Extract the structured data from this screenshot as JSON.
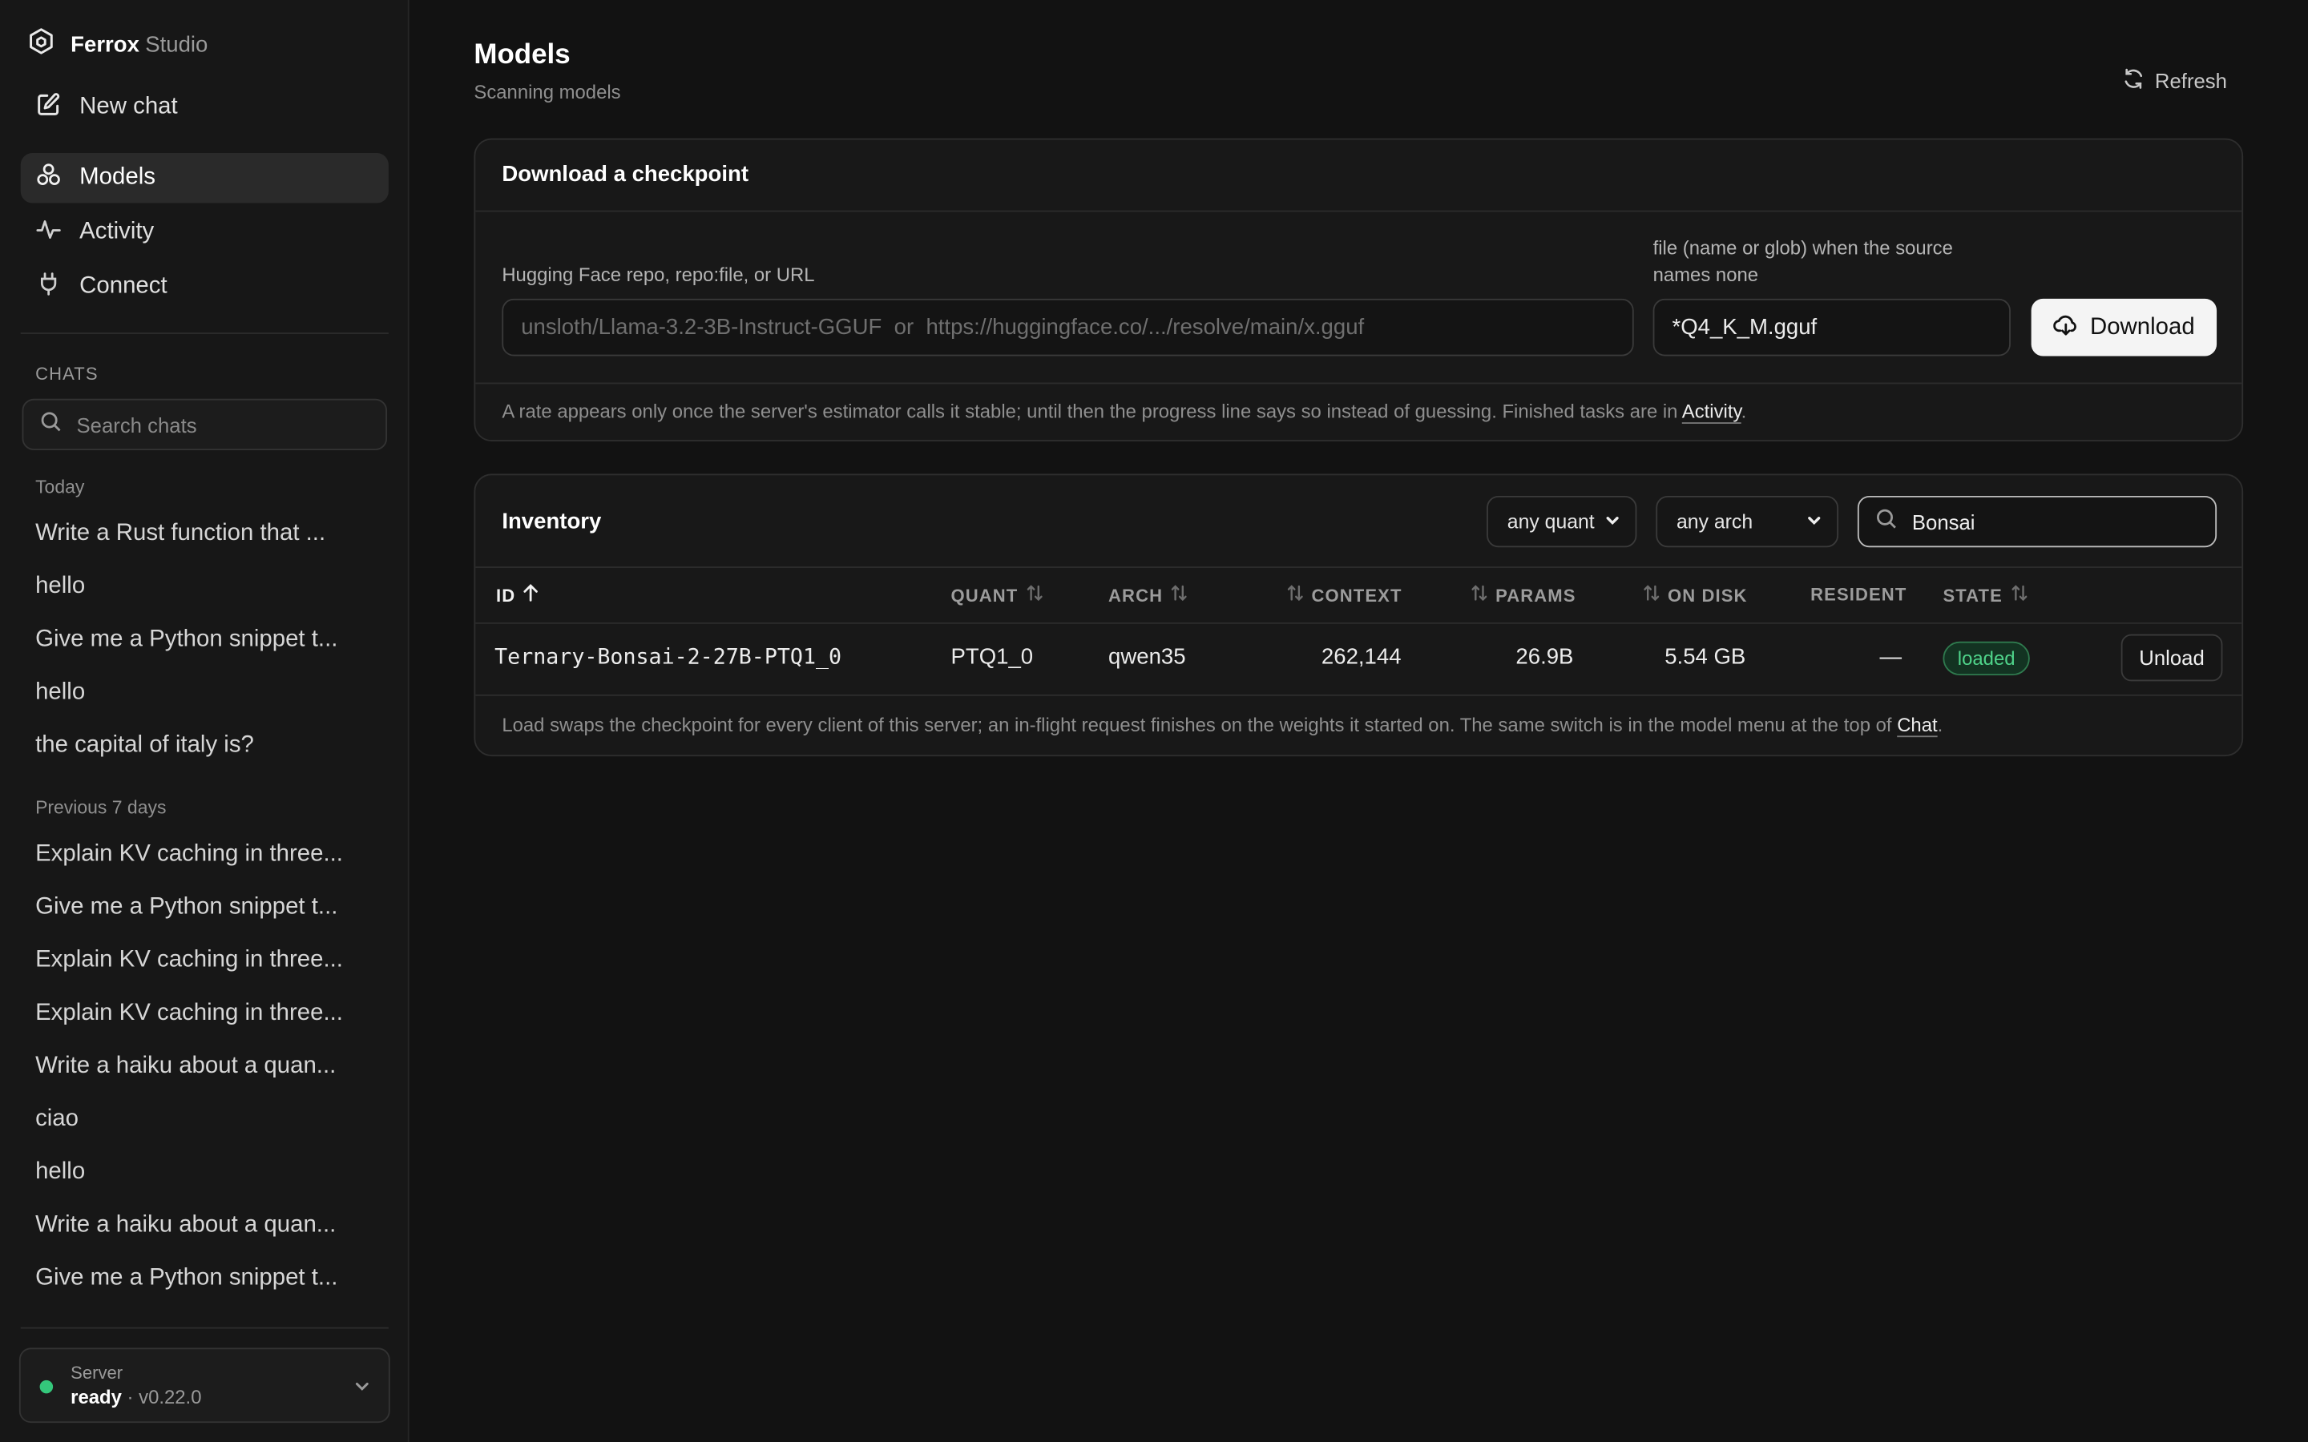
{
  "app": {
    "brand_bold": "Ferrox",
    "brand_light": "Studio"
  },
  "sidebar": {
    "new_chat": "New chat",
    "nav": [
      {
        "label": "Models",
        "icon": "models-icon",
        "active": true
      },
      {
        "label": "Activity",
        "icon": "activity-icon",
        "active": false
      },
      {
        "label": "Connect",
        "icon": "plug-icon",
        "active": false
      }
    ],
    "chats_label": "CHATS",
    "search_placeholder": "Search chats",
    "groups": [
      {
        "label": "Today",
        "items": [
          "Write a Rust function that ...",
          "hello",
          "Give me a Python snippet t...",
          "hello",
          "the capital of italy is?"
        ]
      },
      {
        "label": "Previous 7 days",
        "items": [
          "Explain KV caching in three...",
          "Give me a Python snippet t...",
          "Explain KV caching in three...",
          "Explain KV caching in three...",
          "Write a haiku about a quan...",
          "ciao",
          "hello",
          "Write a haiku about a quan...",
          "Give me a Python snippet t..."
        ]
      }
    ],
    "server": {
      "title": "Server",
      "status": "ready",
      "version": "· v0.22.0",
      "status_color": "#34c77b"
    }
  },
  "main": {
    "title": "Models",
    "subtitle": "Scanning models",
    "refresh_label": "Refresh",
    "download": {
      "title": "Download a checkpoint",
      "repo_label": "Hugging Face repo, repo:file, or URL",
      "repo_placeholder": "unsloth/Llama-3.2-3B-Instruct-GGUF  or  https://huggingface.co/.../resolve/main/x.gguf",
      "file_label": "file (name or glob) when the source names none",
      "file_value": "*Q4_K_M.gguf",
      "button_label": "Download",
      "note_prefix": "A rate appears only once the server's estimator calls it stable; until then the progress line says so instead of guessing. Finished tasks are in ",
      "note_link": "Activity",
      "note_suffix": "."
    },
    "inventory": {
      "title": "Inventory",
      "quant_filter": "any quant",
      "arch_filter": "any arch",
      "search_value": "Bonsai",
      "columns": {
        "id": "ID",
        "quant": "QUANT",
        "arch": "ARCH",
        "context": "CONTEXT",
        "params": "PARAMS",
        "on_disk": "ON DISK",
        "resident": "RESIDENT",
        "state": "STATE"
      },
      "rows": [
        {
          "id": "Ternary-Bonsai-2-27B-PTQ1_0",
          "quant": "PTQ1_0",
          "arch": "qwen35",
          "context": "262,144",
          "params": "26.9B",
          "on_disk": "5.54 GB",
          "resident": "—",
          "state": "loaded",
          "action": "Unload"
        }
      ],
      "footer_prefix": "Load swaps the checkpoint for every client of this server; an in-flight request finishes on the weights it started on. The same switch is in the model menu at the top of ",
      "footer_link": "Chat",
      "footer_suffix": "."
    }
  }
}
